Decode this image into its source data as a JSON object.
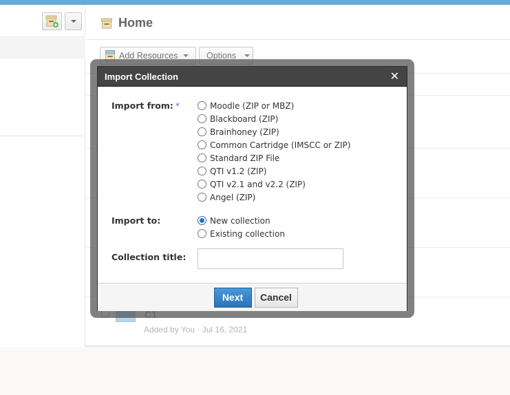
{
  "sidebar": {
    "add_collection_icon": "box-plus-icon",
    "dropdown_icon": "caret-down-icon"
  },
  "header": {
    "title": "Home",
    "title_icon": "box-icon"
  },
  "toolbar": {
    "add_resources_label": "Add Resources",
    "options_label": "Options"
  },
  "list": {
    "items": [
      {
        "name": "C1",
        "meta": "Added by You · Jul 16, 2021"
      }
    ]
  },
  "dialog": {
    "title": "Import Collection",
    "close_icon": "close-icon",
    "import_from": {
      "label": "Import from:",
      "required_mark": "*",
      "options": [
        {
          "label": "Moodle (ZIP or MBZ)",
          "checked": false
        },
        {
          "label": "Blackboard (ZIP)",
          "checked": false
        },
        {
          "label": "Brainhoney (ZIP)",
          "checked": false
        },
        {
          "label": "Common Cartridge (IMSCC or ZIP)",
          "checked": false
        },
        {
          "label": "Standard ZIP File",
          "checked": false
        },
        {
          "label": "QTI v1.2 (ZIP)",
          "checked": false
        },
        {
          "label": "QTI v2.1 and v2.2 (ZIP)",
          "checked": false
        },
        {
          "label": "Angel (ZIP)",
          "checked": false
        }
      ]
    },
    "import_to": {
      "label": "Import to:",
      "options": [
        {
          "label": "New collection",
          "checked": true
        },
        {
          "label": "Existing collection",
          "checked": false
        }
      ]
    },
    "collection_title": {
      "label": "Collection title:",
      "value": "",
      "placeholder": ""
    },
    "next_label": "Next",
    "cancel_label": "Cancel"
  },
  "colors": {
    "accent_bar": "#64abd7",
    "primary_button": "#2a74bc",
    "dialog_header": "#444444"
  }
}
